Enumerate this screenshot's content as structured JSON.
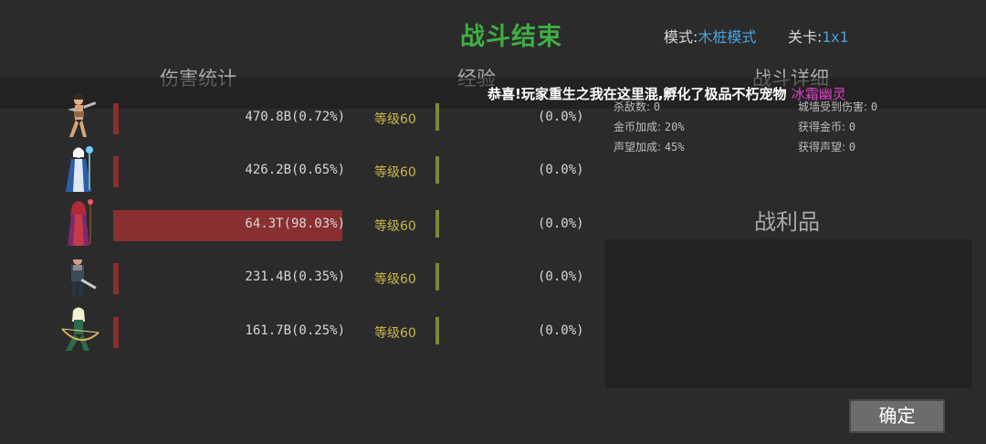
{
  "header": {
    "title": "战斗结束",
    "mode_label": "模式:",
    "mode_value": "木桩模式",
    "stage_label": "关卡:",
    "stage_value": "1x1"
  },
  "sections": {
    "damage": "伤害统计",
    "exp": "经验",
    "detail": "战斗详细",
    "loot": "战利品"
  },
  "banner": {
    "text": "恭喜!玩家重生之我在这里混,孵化了极品不朽宠物",
    "pet": "冰霜幽灵"
  },
  "heroes": [
    {
      "damage": "470.8B(0.72%)",
      "damage_fraction": 0.0072,
      "level": "等级60",
      "exp": "(0.0%)",
      "icon": "warrior-woman-icon"
    },
    {
      "damage": "426.2B(0.65%)",
      "damage_fraction": 0.0065,
      "level": "等级60",
      "exp": "(0.0%)",
      "icon": "ice-mage-icon"
    },
    {
      "damage": "64.3T(98.03%)",
      "damage_fraction": 0.9803,
      "level": "等级60",
      "exp": "(0.0%)",
      "icon": "red-sorceress-icon"
    },
    {
      "damage": "231.4B(0.35%)",
      "damage_fraction": 0.0035,
      "level": "等级60",
      "exp": "(0.0%)",
      "icon": "knight-icon"
    },
    {
      "damage": "161.7B(0.25%)",
      "damage_fraction": 0.0025,
      "level": "等级60",
      "exp": "(0.0%)",
      "icon": "elf-archer-icon"
    }
  ],
  "stats": {
    "kills_label": "杀敌数:",
    "kills_value": "0",
    "wall_damage_label": "城墙受到伤害:",
    "wall_damage_value": "0",
    "gold_bonus_label": "金币加成:",
    "gold_bonus_value": "20%",
    "gold_gain_label": "获得金币:",
    "gold_gain_value": "0",
    "fame_bonus_label": "声望加成:",
    "fame_bonus_value": "45%",
    "fame_gain_label": "获得声望:",
    "fame_gain_value": "0"
  },
  "buttons": {
    "confirm": "确定"
  },
  "colors": {
    "title": "#3fae44",
    "accent_blue": "#4aa3de",
    "damage_bar": "#8a2f2f",
    "level_text": "#c8b84a",
    "pet_name": "#e040c8"
  }
}
